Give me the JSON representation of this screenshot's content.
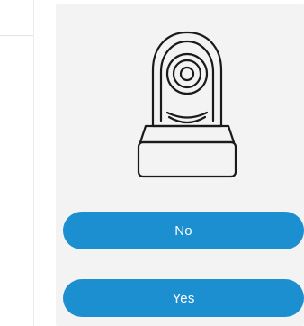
{
  "dialog": {
    "illustration_icon": "security-camera-icon",
    "no_label": "No",
    "yes_label": "Yes"
  },
  "colors": {
    "button": "#1c8fd1",
    "card_background": "#f3f3f3",
    "icon_stroke": "#1a1a1a"
  }
}
